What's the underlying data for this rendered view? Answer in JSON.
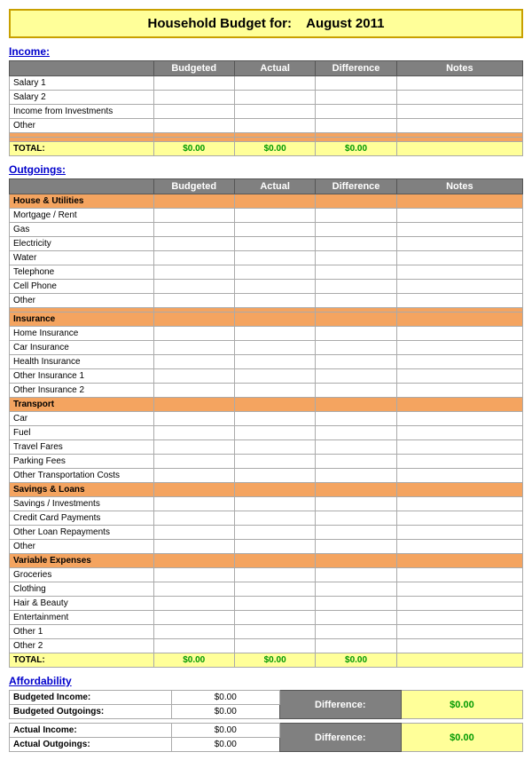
{
  "title": {
    "prefix": "Household Budget for:",
    "month": "August 2011"
  },
  "income": {
    "heading": "Income:",
    "columns": [
      "",
      "Budgeted",
      "Actual",
      "Difference",
      "Notes"
    ],
    "rows": [
      {
        "label": "Salary 1",
        "budgeted": "",
        "actual": "",
        "difference": "",
        "notes": "",
        "type": "data"
      },
      {
        "label": "Salary 2",
        "budgeted": "",
        "actual": "",
        "difference": "",
        "notes": "",
        "type": "data"
      },
      {
        "label": "Income from Investments",
        "budgeted": "",
        "actual": "",
        "difference": "",
        "notes": "",
        "type": "data"
      },
      {
        "label": "Other",
        "budgeted": "",
        "actual": "",
        "difference": "",
        "notes": "",
        "type": "data"
      },
      {
        "label": "",
        "budgeted": "",
        "actual": "",
        "difference": "",
        "notes": "",
        "type": "empty"
      },
      {
        "label": "",
        "budgeted": "",
        "actual": "",
        "difference": "",
        "notes": "",
        "type": "empty"
      },
      {
        "label": "TOTAL:",
        "budgeted": "$0.00",
        "actual": "$0.00",
        "difference": "$0.00",
        "notes": "",
        "type": "total"
      }
    ]
  },
  "outgoings": {
    "heading": "Outgoings:",
    "columns": [
      "",
      "Budgeted",
      "Actual",
      "Difference",
      "Notes"
    ],
    "rows": [
      {
        "label": "House & Utilities",
        "type": "category"
      },
      {
        "label": "Mortgage / Rent",
        "type": "data"
      },
      {
        "label": "Gas",
        "type": "data"
      },
      {
        "label": "Electricity",
        "type": "data"
      },
      {
        "label": "Water",
        "type": "data"
      },
      {
        "label": "Telephone",
        "type": "data"
      },
      {
        "label": "Cell Phone",
        "type": "data"
      },
      {
        "label": "Other",
        "type": "data"
      },
      {
        "label": "",
        "type": "empty"
      },
      {
        "label": "Insurance",
        "type": "category"
      },
      {
        "label": "Home Insurance",
        "type": "data"
      },
      {
        "label": "Car Insurance",
        "type": "data"
      },
      {
        "label": "Health Insurance",
        "type": "data"
      },
      {
        "label": "Other Insurance 1",
        "type": "data"
      },
      {
        "label": "Other Insurance 2",
        "type": "data"
      },
      {
        "label": "Transport",
        "type": "category"
      },
      {
        "label": "Car",
        "type": "data"
      },
      {
        "label": "Fuel",
        "type": "data"
      },
      {
        "label": "Travel Fares",
        "type": "data"
      },
      {
        "label": "Parking Fees",
        "type": "data"
      },
      {
        "label": "Other Transportation Costs",
        "type": "data"
      },
      {
        "label": "Savings & Loans",
        "type": "category"
      },
      {
        "label": "Savings / Investments",
        "type": "data"
      },
      {
        "label": "Credit Card Payments",
        "type": "data"
      },
      {
        "label": "Other Loan Repayments",
        "type": "data"
      },
      {
        "label": "Other",
        "type": "data"
      },
      {
        "label": "Variable Expenses",
        "type": "category"
      },
      {
        "label": "Groceries",
        "type": "data"
      },
      {
        "label": "Clothing",
        "type": "data"
      },
      {
        "label": "Hair & Beauty",
        "type": "data"
      },
      {
        "label": "Entertainment",
        "type": "data"
      },
      {
        "label": "Other 1",
        "type": "data"
      },
      {
        "label": "Other 2",
        "type": "data"
      },
      {
        "label": "TOTAL:",
        "budgeted": "$0.00",
        "actual": "$0.00",
        "difference": "$0.00",
        "type": "total"
      }
    ]
  },
  "affordability": {
    "heading": "Affordability",
    "budgeted_income_label": "Budgeted Income:",
    "budgeted_income_value": "$0.00",
    "budgeted_outgoings_label": "Budgeted Outgoings:",
    "budgeted_outgoings_value": "$0.00",
    "actual_income_label": "Actual Income:",
    "actual_income_value": "$0.00",
    "actual_outgoings_label": "Actual Outgoings:",
    "actual_outgoings_value": "$0.00",
    "difference_label": "Difference:",
    "budgeted_difference_value": "$0.00",
    "actual_difference_value": "$0.00"
  }
}
